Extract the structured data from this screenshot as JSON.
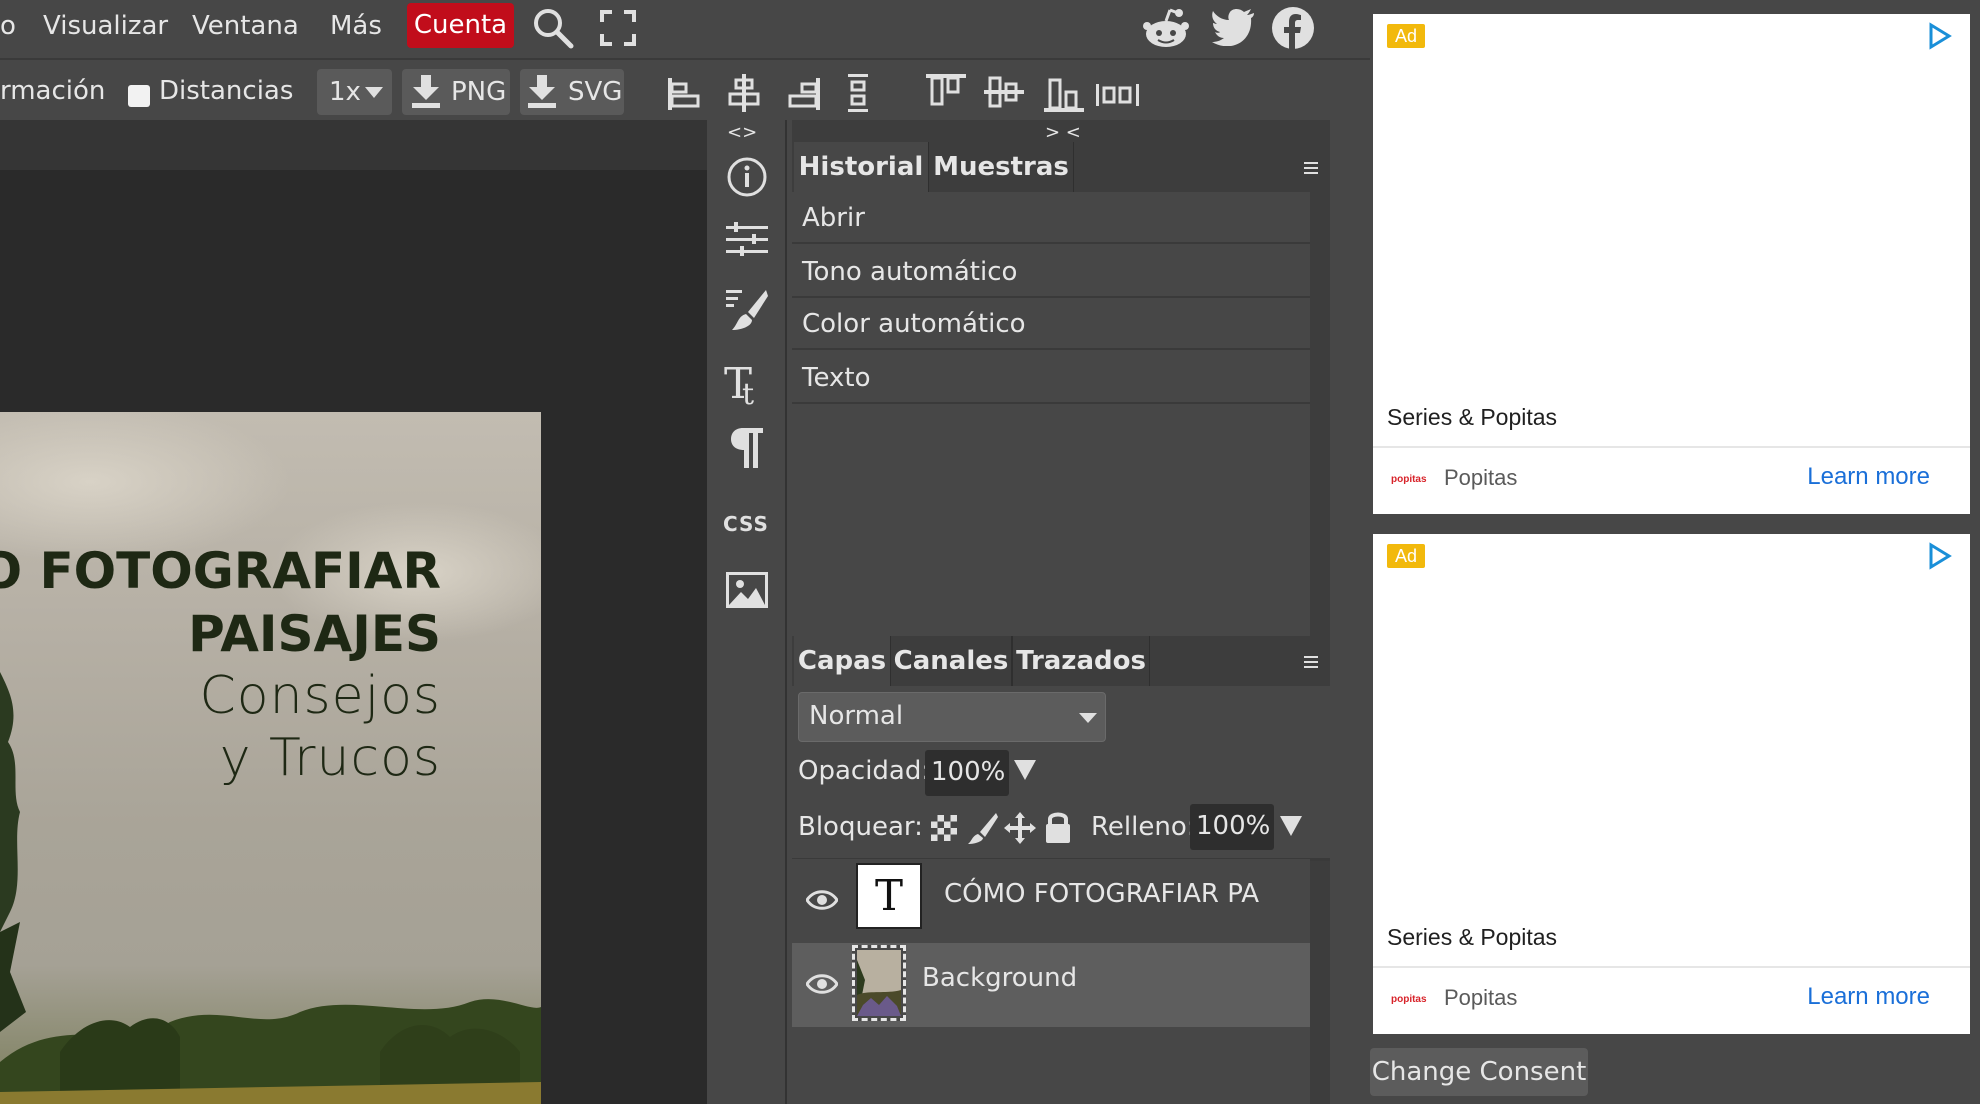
{
  "menubar": {
    "partial_item": "o",
    "items": [
      "Visualizar",
      "Ventana",
      "Más"
    ],
    "account_label": "Cuenta"
  },
  "toolbar": {
    "partial_label": "rmación",
    "distances_label": "Distancias",
    "scale_value": "1x",
    "png_label": "PNG",
    "svg_label": "SVG"
  },
  "collapse": {
    "left": "<>",
    "right": "> <"
  },
  "document": {
    "title_line1": "O FOTOGRAFIAR",
    "title_line2": "PAISAJES",
    "subtitle_line1": "Consejos",
    "subtitle_line2": "y Trucos"
  },
  "tools": {
    "css_label": "CSS"
  },
  "history_panel": {
    "tabs": [
      "Historial",
      "Muestras"
    ],
    "entries": [
      "Abrir",
      "Tono automático",
      "Color automático",
      "Texto"
    ]
  },
  "layers_panel": {
    "tabs": [
      "Capas",
      "Canales",
      "Trazados"
    ],
    "blend_mode": "Normal",
    "opacity_label": "Opacidad:",
    "opacity_value": "100%",
    "lock_label": "Bloquear:",
    "fill_label": "Relleno:",
    "fill_value": "100%",
    "layers": [
      {
        "name": "CÓMO FOTOGRAFIAR PA",
        "thumb": "T"
      },
      {
        "name": "Background"
      }
    ]
  },
  "ads": [
    {
      "badge": "Ad",
      "title": "Series & Popitas",
      "brand": "Popitas",
      "logo_text": "popitas",
      "cta": "Learn more"
    },
    {
      "badge": "Ad",
      "title": "Series & Popitas",
      "brand": "Popitas",
      "logo_text": "popitas",
      "cta": "Learn more"
    }
  ],
  "consent_label": "Change Consent",
  "colors": {
    "account_button": "#c10d1b",
    "ad_badge": "#f2b90c",
    "link": "#1a6fd8",
    "panel_bg": "#474747",
    "canvas_bg": "#2a2a2a"
  }
}
